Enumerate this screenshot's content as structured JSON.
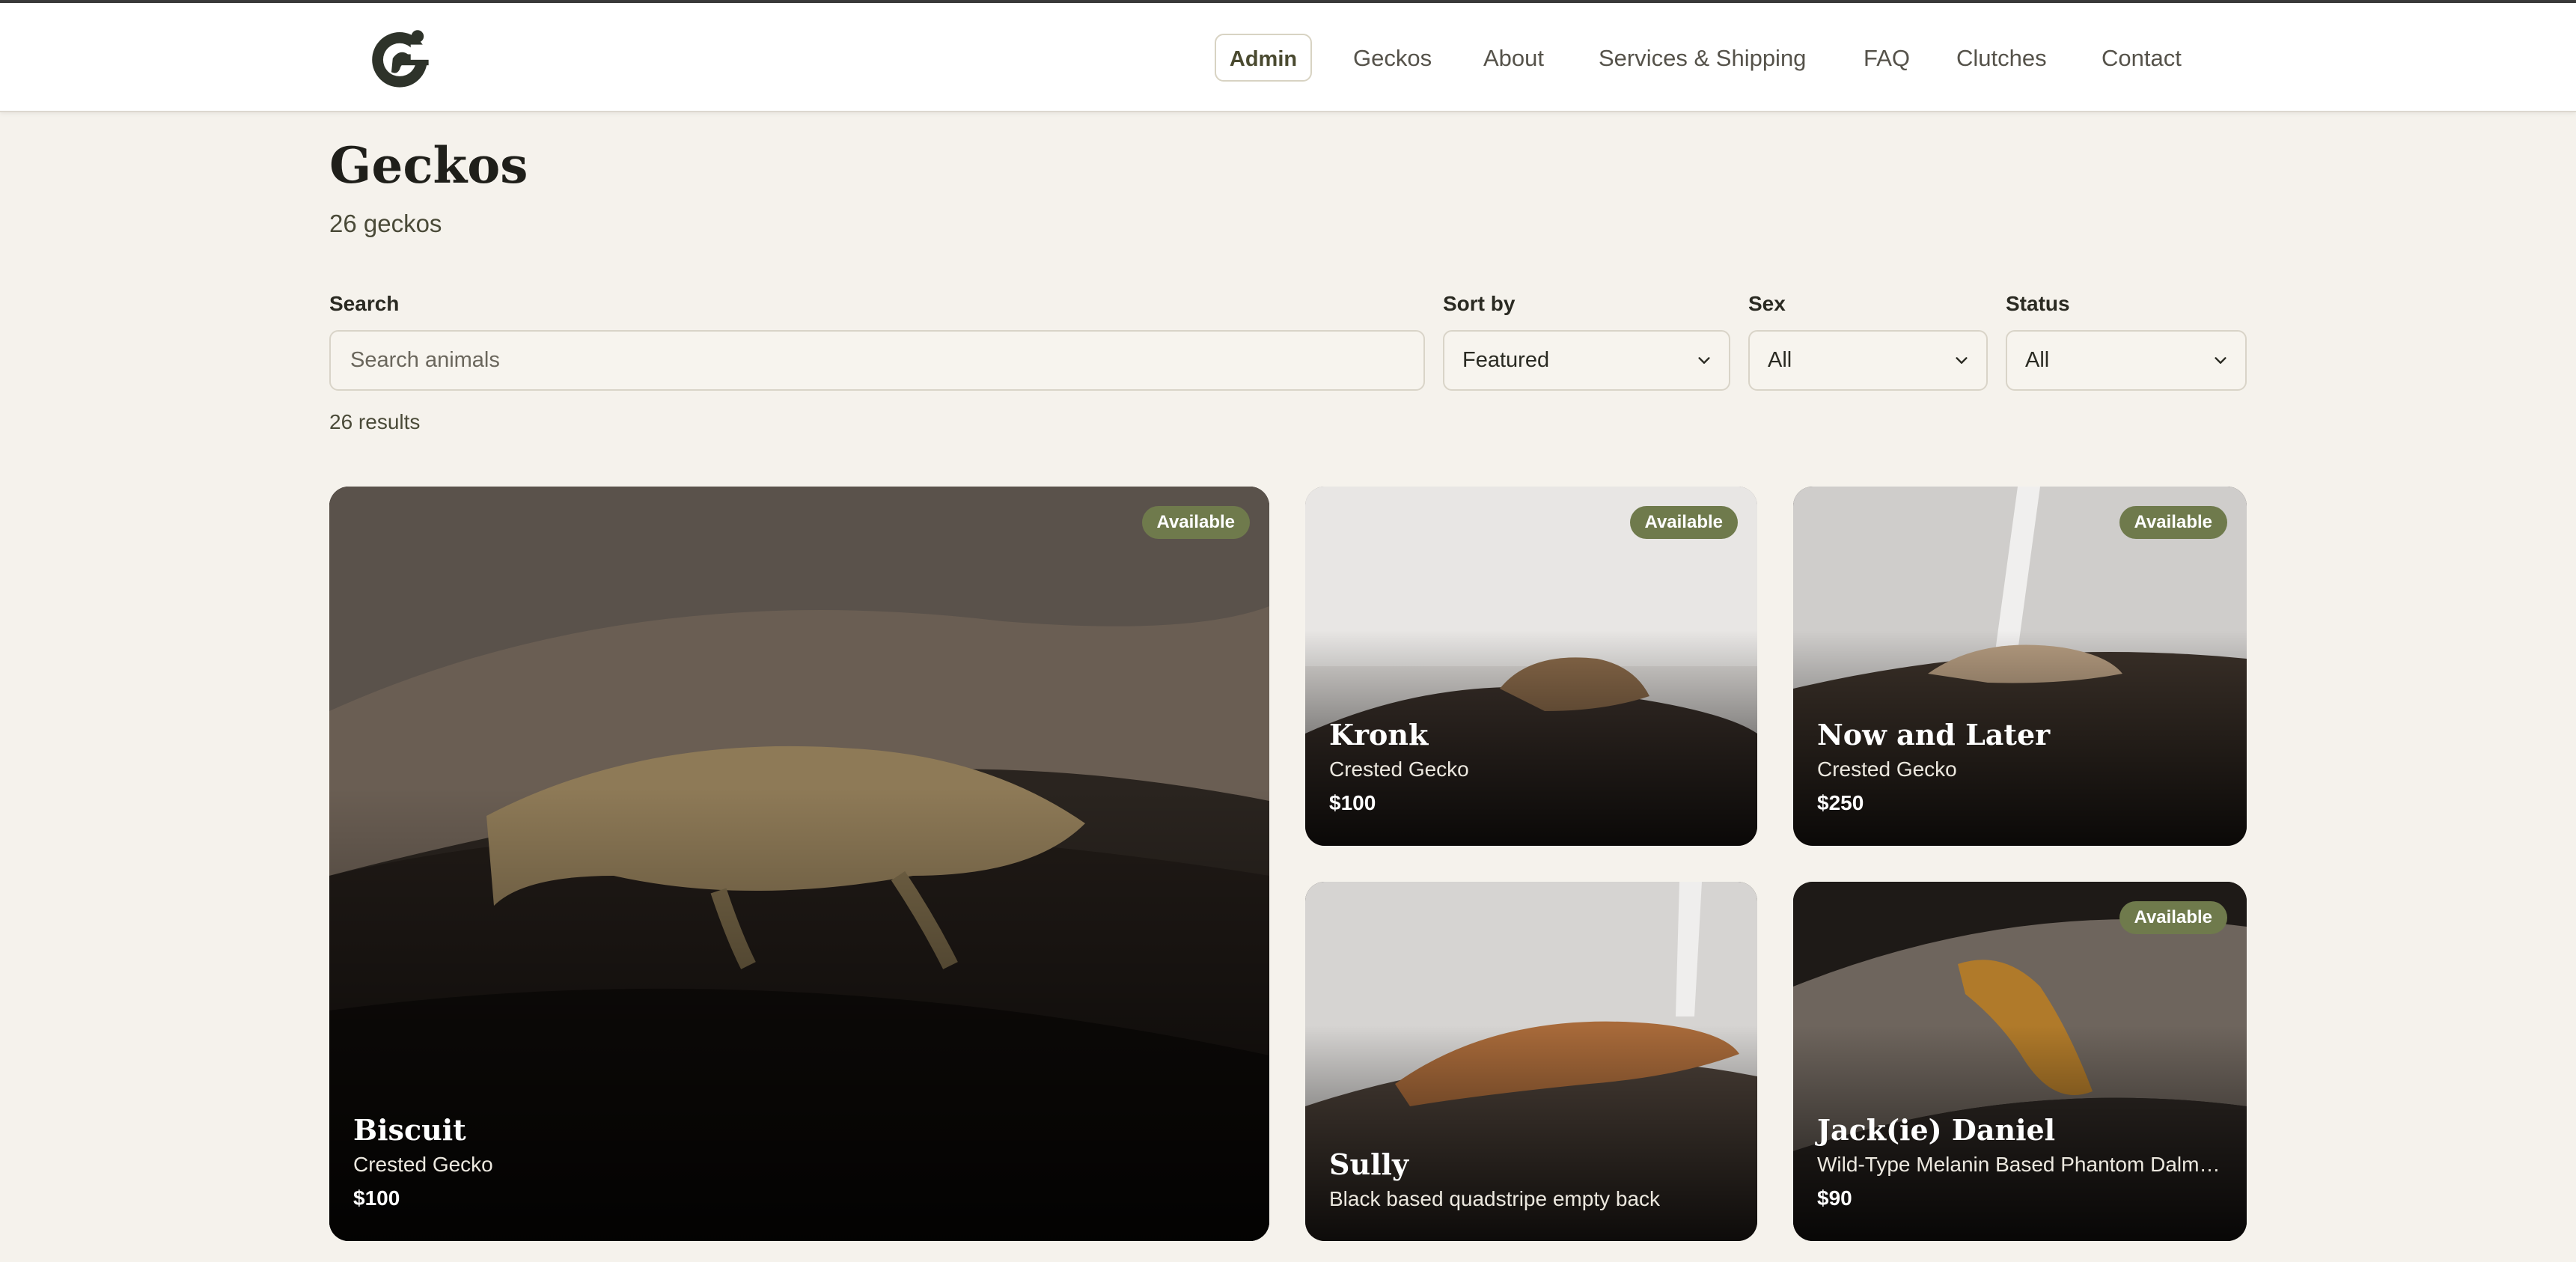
{
  "nav": {
    "admin_label": "Admin",
    "links": [
      "Geckos",
      "About",
      "Services & Shipping",
      "FAQ",
      "Clutches",
      "Contact"
    ]
  },
  "page": {
    "title": "Geckos",
    "count_text": "26 geckos",
    "results_text": "26 results"
  },
  "filters": {
    "search_label": "Search",
    "search_placeholder": "Search animals",
    "search_value": "",
    "sort_label": "Sort by",
    "sort_value": "Featured",
    "sex_label": "Sex",
    "sex_value": "All",
    "status_label": "Status",
    "status_value": "All"
  },
  "cards": [
    {
      "name": "Biscuit",
      "species": "Crested Gecko",
      "price": "$100",
      "badge": "Available"
    },
    {
      "name": "Kronk",
      "species": "Crested Gecko",
      "price": "$100",
      "badge": "Available"
    },
    {
      "name": "Now and Later",
      "species": "Crested Gecko",
      "price": "$250",
      "badge": "Available"
    },
    {
      "name": "Sully",
      "species": "Black based quadstripe empty back",
      "price": "",
      "badge": ""
    },
    {
      "name": "Jack(ie) Daniel",
      "species": "Wild-Type Melanin Based Phantom Dalmatian",
      "price": "$90",
      "badge": "Available"
    }
  ],
  "colors": {
    "page_background": "#f5f2ec",
    "badge": "#6f7a4c",
    "admin_border": "#d8d3c3"
  },
  "icons": {
    "logo": "gecko-g-logo",
    "select_arrow": "chevron-down-icon"
  }
}
